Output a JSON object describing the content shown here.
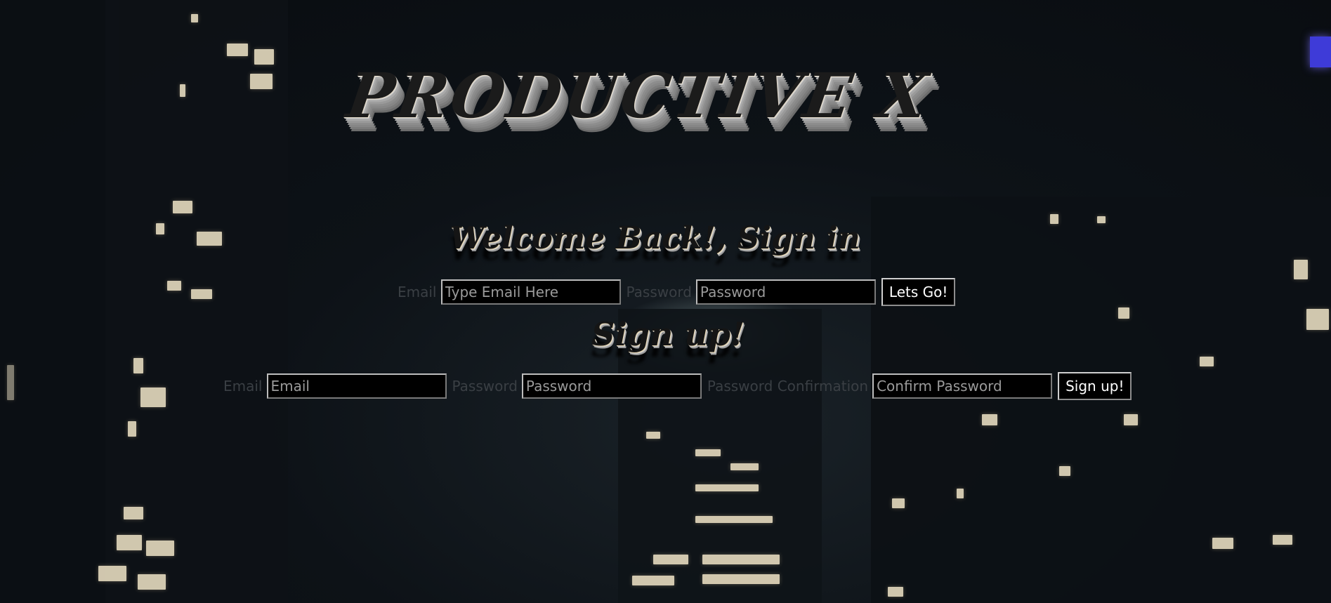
{
  "app": {
    "logo_text": "PRODUCTIVE X"
  },
  "signin": {
    "heading": "Welcome Back!, Sign in",
    "email_label": "Email",
    "email_placeholder": "Type Email Here",
    "password_label": "Password",
    "password_placeholder": "Password",
    "submit_label": "Lets Go!"
  },
  "signup": {
    "heading": "Sign up!",
    "email_label": "Email",
    "email_placeholder": "Email",
    "password_label": "Password",
    "password_placeholder": "Password",
    "confirm_label": "Password Confirmation",
    "confirm_placeholder": "Confirm Password",
    "submit_label": "Sign up!"
  },
  "colors": {
    "background": "#0b0f13",
    "field_background": "#000000",
    "label_text": "#3a3f44",
    "city_light": "#f3e7c9",
    "blue_sign": "#3e3bd8"
  }
}
